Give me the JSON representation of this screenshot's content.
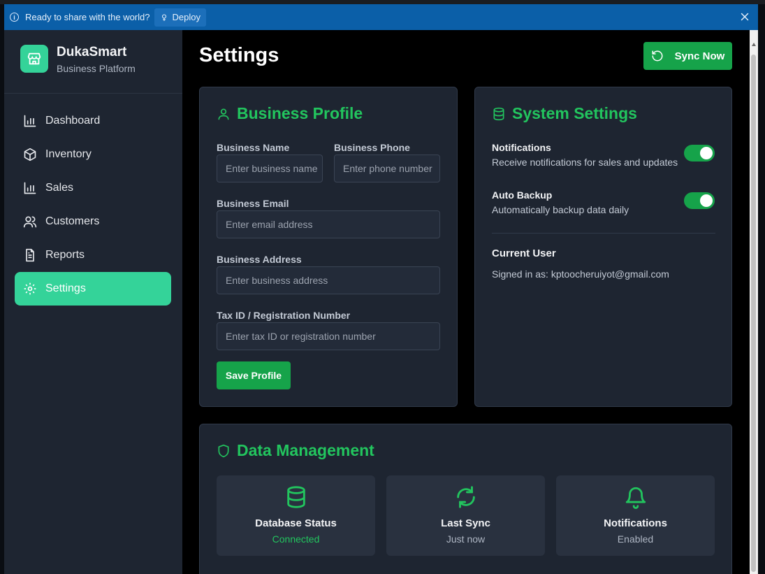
{
  "banner": {
    "message": "Ready to share with the world?",
    "deploy_label": "Deploy"
  },
  "brand": {
    "name": "DukaSmart",
    "subtitle": "Business Platform"
  },
  "sidebar": {
    "items": [
      {
        "label": "Dashboard"
      },
      {
        "label": "Inventory"
      },
      {
        "label": "Sales"
      },
      {
        "label": "Customers"
      },
      {
        "label": "Reports"
      },
      {
        "label": "Settings",
        "active": true
      }
    ]
  },
  "page": {
    "title": "Settings",
    "sync_label": "Sync Now"
  },
  "business_profile": {
    "title": "Business Profile",
    "name_label": "Business Name",
    "name_placeholder": "Enter business name",
    "phone_label": "Business Phone",
    "phone_placeholder": "Enter phone number",
    "email_label": "Business Email",
    "email_placeholder": "Enter email address",
    "address_label": "Business Address",
    "address_placeholder": "Enter business address",
    "tax_label": "Tax ID / Registration Number",
    "tax_placeholder": "Enter tax ID or registration number",
    "save_label": "Save Profile"
  },
  "system_settings": {
    "title": "System Settings",
    "notifications": {
      "title": "Notifications",
      "desc": "Receive notifications for sales and updates",
      "enabled": true
    },
    "auto_backup": {
      "title": "Auto Backup",
      "desc": "Automatically backup data daily",
      "enabled": true
    },
    "current_user": {
      "title": "Current User",
      "signed_in": "Signed in as: kptoocheruiyot@gmail.com"
    }
  },
  "data_management": {
    "title": "Data Management",
    "tiles": [
      {
        "title": "Database Status",
        "status": "Connected",
        "icon": "database-icon"
      },
      {
        "title": "Last Sync",
        "status": "Just now",
        "icon": "refresh-icon"
      },
      {
        "title": "Notifications",
        "status": "Enabled",
        "icon": "bell-icon"
      }
    ]
  },
  "colors": {
    "accent": "#22c55e",
    "button": "#16a34a",
    "active_nav": "#34d399",
    "banner": "#0b5fa8",
    "panel": "#1e2531"
  }
}
